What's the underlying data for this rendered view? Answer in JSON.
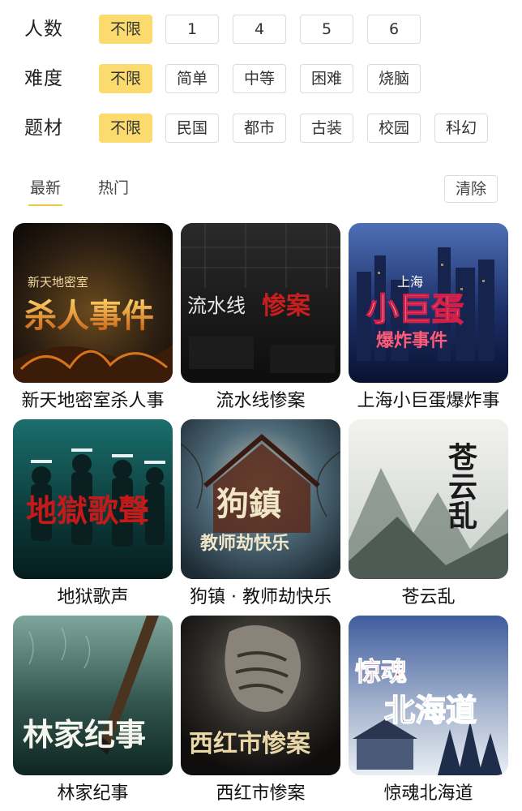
{
  "filters": [
    {
      "label": "人数",
      "options": [
        "不限",
        "1",
        "4",
        "5",
        "6"
      ],
      "selected": "不限"
    },
    {
      "label": "难度",
      "options": [
        "不限",
        "简单",
        "中等",
        "困难",
        "烧脑"
      ],
      "selected": "不限"
    },
    {
      "label": "题材",
      "options": [
        "不限",
        "民国",
        "都市",
        "古装",
        "校园",
        "科幻"
      ],
      "selected": "不限"
    }
  ],
  "sort": {
    "tabs": [
      "最新",
      "热门"
    ],
    "active": "最新",
    "clear_label": "清除"
  },
  "accent_color": "#fbdb6e",
  "cards": [
    {
      "title": "新天地密室杀人事",
      "cover_text": [
        "新天地密室",
        "杀人事件"
      ]
    },
    {
      "title": "流水线惨案",
      "cover_text": [
        "流水线",
        "惨案"
      ]
    },
    {
      "title": "上海小巨蛋爆炸事",
      "cover_text": [
        "上海",
        "小巨蛋",
        "爆炸事件"
      ]
    },
    {
      "title": "地狱歌声",
      "cover_text": [
        "地獄歌聲"
      ]
    },
    {
      "title": "狗镇 · 教师劫快乐",
      "cover_text": [
        "狗鎮",
        "教师劫快乐"
      ]
    },
    {
      "title": "苍云乱",
      "cover_text": [
        "苍云乱"
      ]
    },
    {
      "title": "林家纪事",
      "cover_text": [
        "林家纪事"
      ]
    },
    {
      "title": "西红市惨案",
      "cover_text": [
        "西红市惨案"
      ]
    },
    {
      "title": "惊魂北海道",
      "cover_text": [
        "惊魂",
        "北海道"
      ]
    }
  ]
}
